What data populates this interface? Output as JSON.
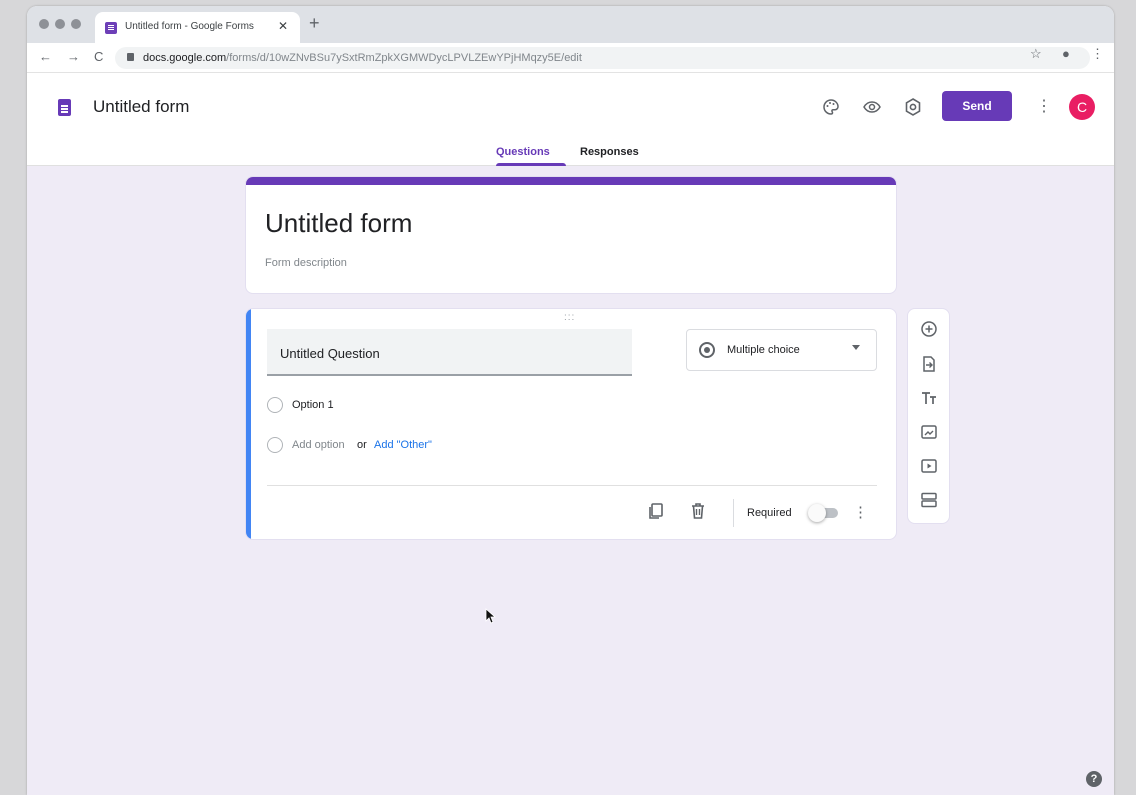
{
  "browser": {
    "tab_title": "Untitled form - Google Forms",
    "tab_close": "✕",
    "new_tab": "+",
    "url_host": "docs.google.com",
    "url_path": "/forms/d/10wZNvBSu7ySxtRmZpkXGMWDycLPVLZEwYPjHMqzy5E/edit",
    "back": "←",
    "forward": "→",
    "reload": "C",
    "star": "☆",
    "profile": "●",
    "menu": "⋮"
  },
  "header": {
    "title": "Untitled form",
    "send_label": "Send",
    "avatar_letter": "C",
    "more": "⋮",
    "tabs": [
      {
        "label": "Questions"
      },
      {
        "label": "Responses"
      }
    ]
  },
  "form": {
    "title": "Untitled form",
    "description_placeholder": "Form description"
  },
  "question": {
    "drag_handle": ":::",
    "title": "Untitled Question",
    "type": "Multiple choice",
    "options": [
      {
        "label": "Option 1"
      }
    ],
    "add_option": "Add option",
    "or": "or",
    "add_other": "Add \"Other\"",
    "required_label": "Required",
    "required": false,
    "more": "⋮"
  },
  "help": "?",
  "colors": {
    "accent": "#673ab7",
    "active_card": "#4285f4",
    "background": "#efebf6",
    "avatar": "#e91e63"
  }
}
